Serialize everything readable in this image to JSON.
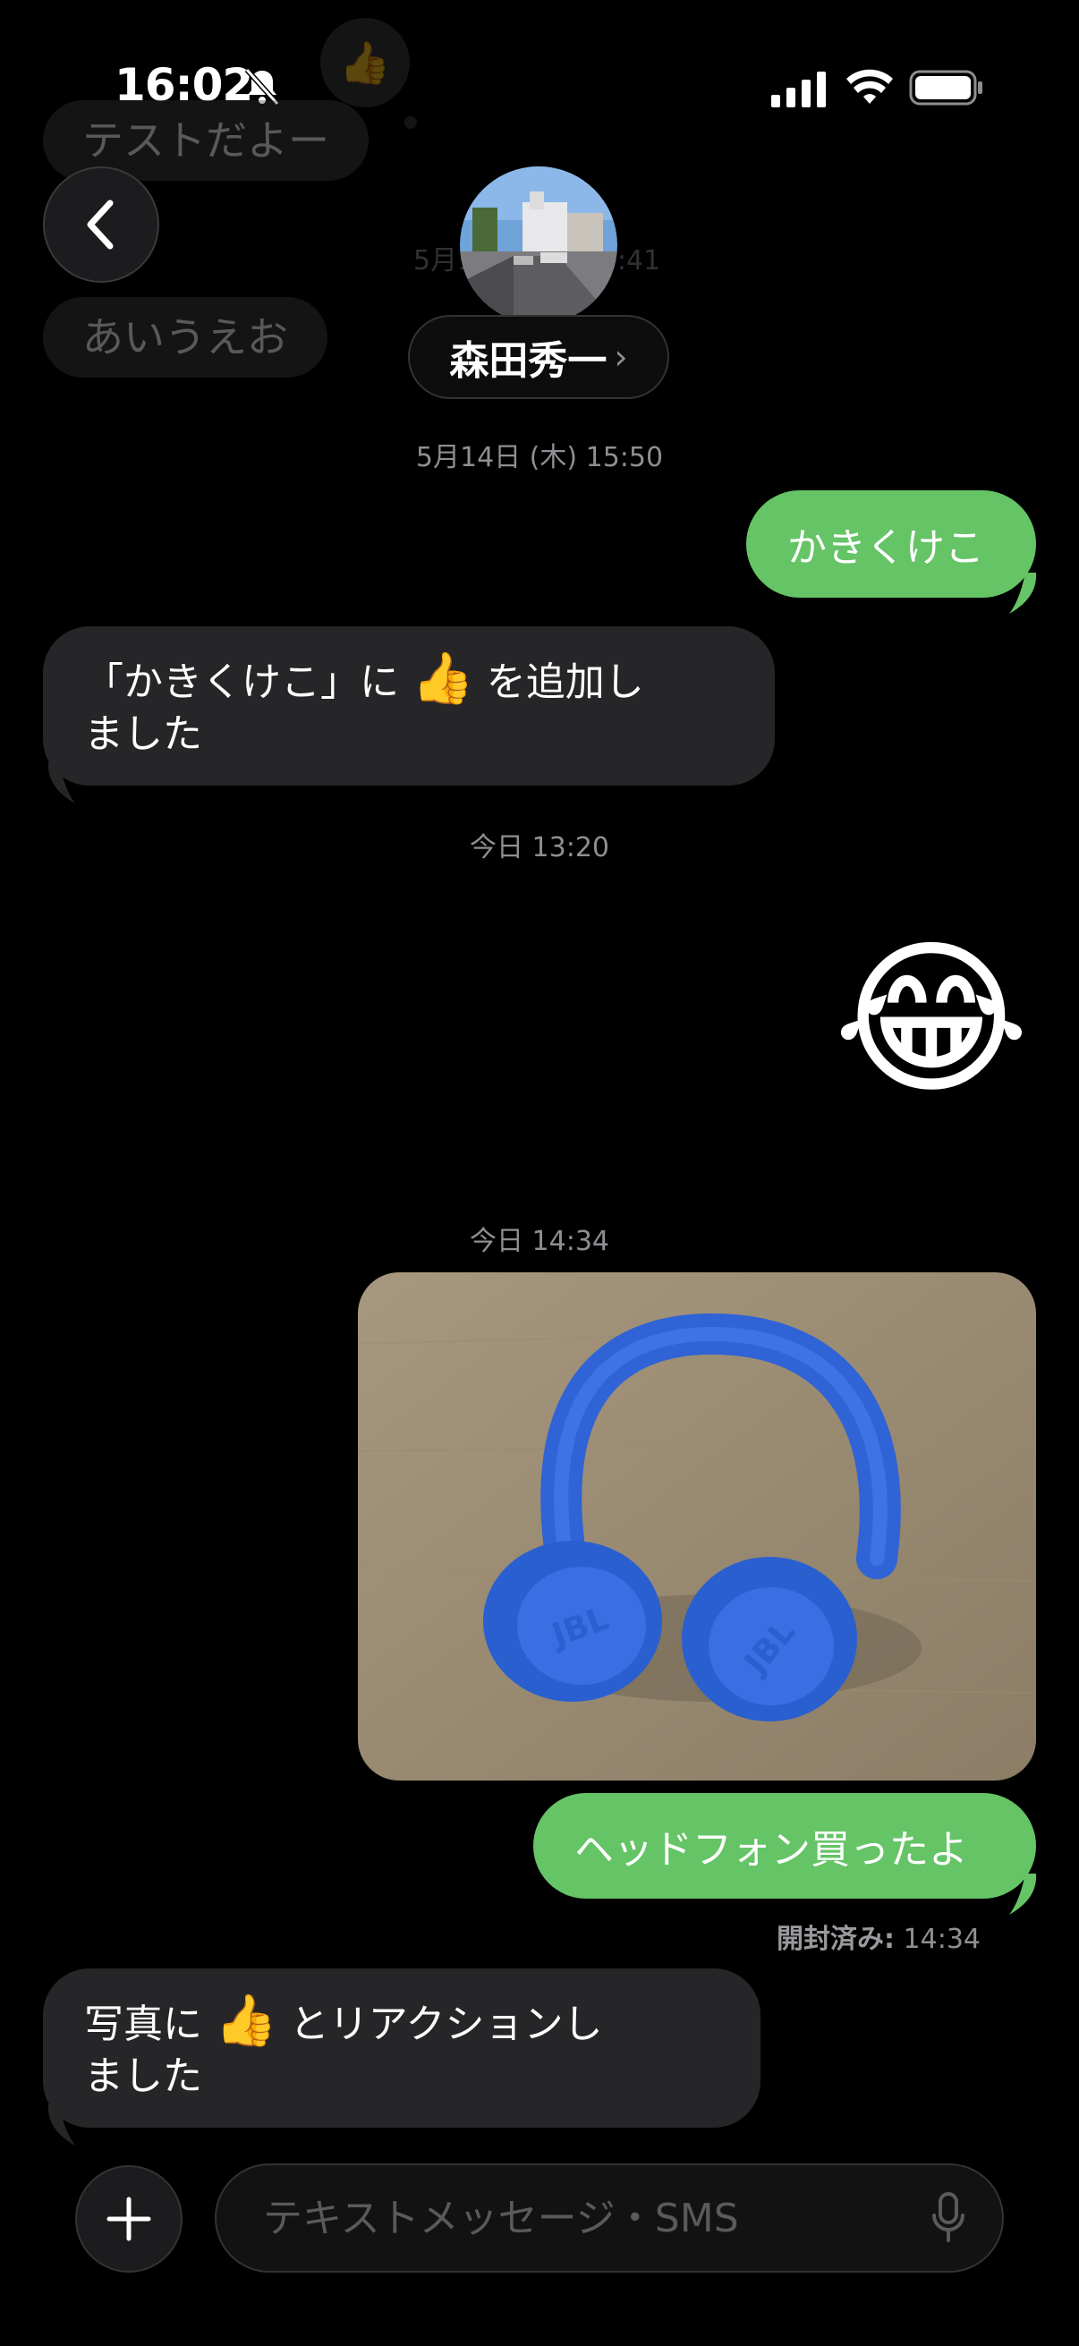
{
  "status_bar": {
    "time": "16:02"
  },
  "faded_history": {
    "bubble1": "テストだよー",
    "bubble2": "あいうえお",
    "timestamp": "5月14日 (木) 15:41"
  },
  "header": {
    "contact_name": "森田秀一",
    "name_chevron": "›"
  },
  "messages": [
    {
      "type": "timestamp",
      "text": "5月14日 (木) 15:50"
    },
    {
      "type": "outgoing",
      "text": "かきくけこ"
    },
    {
      "type": "incoming",
      "line1_before": "「かきくけこ」に",
      "emoji": "👍",
      "line1_after": "を追加し",
      "line2": "ました"
    },
    {
      "type": "timestamp",
      "text": "今日 13:20"
    },
    {
      "type": "emoji",
      "text": "😂"
    },
    {
      "type": "timestamp",
      "text": "今日 14:34"
    },
    {
      "type": "photo",
      "description": "blue JBL headphones"
    },
    {
      "type": "outgoing",
      "text": "ヘッドフォン買ったよ"
    },
    {
      "type": "incoming",
      "line1_before": "写真に",
      "emoji": "👍",
      "line1_after": "とリアクションし",
      "line2": "ました"
    }
  ],
  "read_receipt": {
    "label": "開封済み:",
    "time": "14:34"
  },
  "composer": {
    "placeholder": "テキストメッセージ・SMS"
  },
  "photo_logo": "JBL",
  "colors": {
    "outgoing_bubble": "#65c466",
    "incoming_bubble": "#262628",
    "background": "#000000"
  }
}
